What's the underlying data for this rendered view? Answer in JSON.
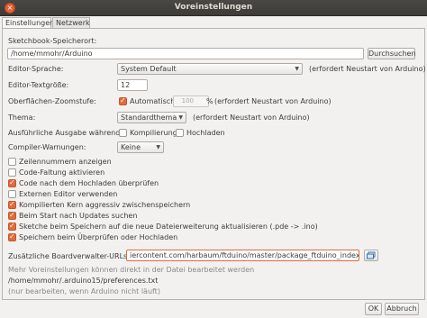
{
  "window": {
    "title": "Voreinstellungen"
  },
  "tabs": [
    "Einstellungen",
    "Netzwerk"
  ],
  "sketchbook": {
    "label": "Sketchbook-Speicherort:",
    "value": "/home/mmohr/Arduino",
    "button": "Durchsuchen"
  },
  "language": {
    "label": "Editor-Sprache:",
    "value": "System Default",
    "note": "(erfordert Neustart von Arduino)"
  },
  "fontsize": {
    "label": "Editor-Textgröße:",
    "value": "12"
  },
  "zoom": {
    "label": "Oberflächen-Zoomstufe:",
    "checkbox_label": "Automatisch",
    "checked": true,
    "value": "100",
    "unit": "%",
    "note": "(erfordert Neustart von Arduino)"
  },
  "theme": {
    "label": "Thema:",
    "value": "Standardthema",
    "note": "(erfordert Neustart von Arduino)"
  },
  "verbose": {
    "label": "Ausführliche Ausgabe während:",
    "compile": {
      "label": "Kompilierung",
      "checked": false
    },
    "upload": {
      "label": "Hochladen",
      "checked": false
    }
  },
  "warnings": {
    "label": "Compiler-Warnungen:",
    "value": "Keine"
  },
  "options": [
    {
      "label": "Zeilennummern anzeigen",
      "checked": false
    },
    {
      "label": "Code-Faltung aktivieren",
      "checked": false
    },
    {
      "label": "Code nach dem Hochladen überprüfen",
      "checked": true
    },
    {
      "label": "Externen Editor verwenden",
      "checked": false
    },
    {
      "label": "Kompilierten Kern aggressiv zwischenspeichern",
      "checked": true
    },
    {
      "label": "Beim Start nach Updates suchen",
      "checked": true
    },
    {
      "label": "Sketche beim Speichern auf die neue Dateierweiterung aktualisieren (.pde -> .ino)",
      "checked": true
    },
    {
      "label": "Speichern beim Überprüfen oder Hochladen",
      "checked": true
    }
  ],
  "boards_url": {
    "label": "Zusätzliche Boardverwalter-URLs:",
    "value": "iercontent.com/harbaum/ftduino/master/package_ftduino_index.json"
  },
  "info": {
    "line1": "Mehr Voreinstellungen können direkt in der Datei bearbeitet werden",
    "line2": "/home/mmohr/.arduino15/preferences.txt",
    "line3": "(nur bearbeiten, wenn Arduino nicht läuft)"
  },
  "footer": {
    "ok": "OK",
    "cancel": "Abbruch"
  },
  "colors": {
    "accent": "#e26b3b",
    "titlebar": "#3c3b37"
  }
}
